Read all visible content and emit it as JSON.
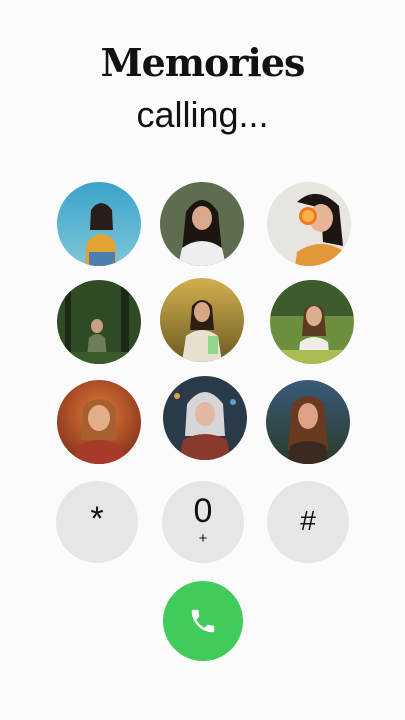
{
  "header": {
    "title": "Memories",
    "status": "calling..."
  },
  "contacts": [
    {
      "icon": "contact-photo-woman-blue-sky"
    },
    {
      "icon": "contact-photo-woman-dark-hair"
    },
    {
      "icon": "contact-photo-woman-orange-slice"
    },
    {
      "icon": "contact-photo-woman-forest"
    },
    {
      "icon": "contact-photo-woman-sunset-field"
    },
    {
      "icon": "contact-photo-woman-meadow"
    },
    {
      "icon": "contact-photo-woman-warm-portrait"
    },
    {
      "icon": "contact-photo-woman-silver-hair"
    },
    {
      "icon": "contact-photo-woman-dusk"
    }
  ],
  "keypad": [
    {
      "main": "*",
      "sub": ""
    },
    {
      "main": "0",
      "sub": "+"
    },
    {
      "main": "#",
      "sub": ""
    }
  ],
  "call": {
    "icon": "phone-icon",
    "color": "#3fcc5a"
  }
}
